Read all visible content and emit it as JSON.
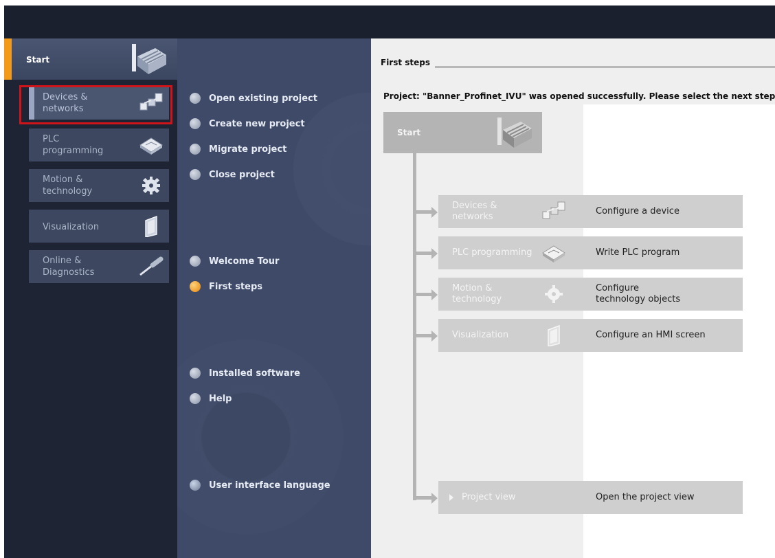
{
  "leftnav": {
    "start_label": "Start",
    "items": [
      {
        "label": "Devices &\nnetworks",
        "icon": "devices-networks-icon",
        "selected": true
      },
      {
        "label": "PLC\nprogramming",
        "icon": "plc-programming-icon",
        "selected": false
      },
      {
        "label": "Motion &\ntechnology",
        "icon": "motion-technology-icon",
        "selected": false
      },
      {
        "label": "Visualization",
        "icon": "visualization-icon",
        "selected": false
      },
      {
        "label": "Online &\nDiagnostics",
        "icon": "online-diagnostics-icon",
        "selected": false
      }
    ]
  },
  "options": {
    "open_existing": "Open existing project",
    "create_new": "Create new project",
    "migrate": "Migrate project",
    "close": "Close project",
    "welcome_tour": "Welcome Tour",
    "first_steps": "First steps",
    "installed_software": "Installed software",
    "help": "Help",
    "ui_language": "User interface language"
  },
  "content": {
    "heading": "First steps",
    "message": "Project: \"Banner_Profinet_IVU\" was opened successfully. Please select the next step:",
    "start_label": "Start",
    "steps": [
      {
        "title": "Devices &\nnetworks",
        "desc": "Configure a device"
      },
      {
        "title": "PLC programming",
        "desc": "Write PLC program"
      },
      {
        "title": "Motion &\ntechnology",
        "desc": "Configure\ntechnology objects"
      },
      {
        "title": "Visualization",
        "desc": "Configure an HMI screen"
      },
      {
        "title": "Project view",
        "desc": "Open the project view"
      }
    ]
  },
  "colors": {
    "accent": "#f39a18",
    "highlight_frame": "#d0141a",
    "nav_bg": "#1f2434",
    "options_bg": "#3e4a68"
  }
}
